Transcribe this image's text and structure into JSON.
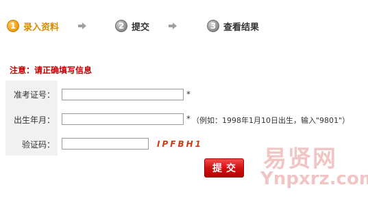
{
  "steps": [
    {
      "number": "1",
      "label": "录入资料",
      "state": "active"
    },
    {
      "number": "2",
      "label": "提交",
      "state": "inactive"
    },
    {
      "number": "3",
      "label": "查看结果",
      "state": "inactive"
    }
  ],
  "notice": "注意：请正确填写信息",
  "form": {
    "exam_number": {
      "label": "准考证号：",
      "value": "",
      "required_mark": "*"
    },
    "birth_date": {
      "label": "出生年月：",
      "value": "",
      "required_mark": "*",
      "hint": "（例如：1998年1月10日出生，输入\"9801\"）"
    },
    "captcha": {
      "label": "验证码：",
      "value": "",
      "code": "IPFBH1"
    }
  },
  "submit_label": "提交",
  "watermark": {
    "cn": "易贤网",
    "en": "Ynpxrz.com"
  },
  "colors": {
    "active_step": "#d98a00",
    "notice": "#c40000",
    "captcha_code": "#d33a16",
    "submit_button": "#d31111"
  }
}
